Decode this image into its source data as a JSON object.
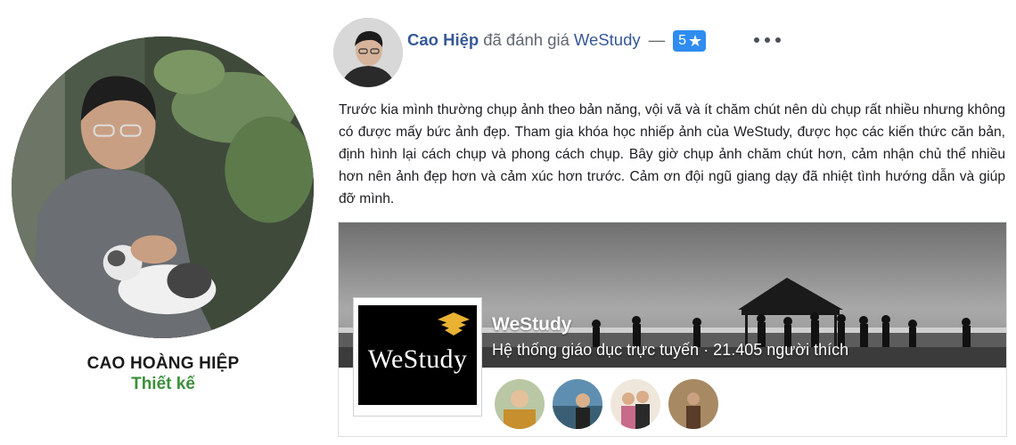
{
  "profile": {
    "name": "CAO HOÀNG HIỆP",
    "role": "Thiết kế"
  },
  "review": {
    "reviewer": "Cao Hiệp",
    "verb": "đã đánh giá",
    "page": "WeStudy",
    "separator": "—",
    "rating": "5",
    "rating_icon": "star-icon",
    "more_icon": "more-options-icon",
    "text": "Trước kia mình thường chụp ảnh theo bản năng, vội vã và ít chăm chút nên dù chụp rất nhiều nhưng không có được mấy bức ảnh đẹp. Tham gia khóa học nhiếp ảnh của WeStudy, được học các kiến thức căn bản, định hình lại cách chụp và phong cách chụp. Bây giờ chụp ảnh chăm chút hơn, cảm nhận chủ thể nhiều hơn nên ảnh đẹp hơn và cảm xúc hơn trước. Cảm ơn đội ngũ giang dạy đã nhiệt tình hướng dẫn và giúp đỡ mình."
  },
  "page_card": {
    "name": "WeStudy",
    "logo_text": "WeStudy",
    "subtitle": "Hệ thống giáo dục trực tuyến · 21.405 người thích",
    "liker_count": 4
  },
  "colors": {
    "link": "#365899",
    "rating_badge": "#2f8cf0",
    "role": "#3b8f3b",
    "logo_accent": "#e9b233"
  }
}
